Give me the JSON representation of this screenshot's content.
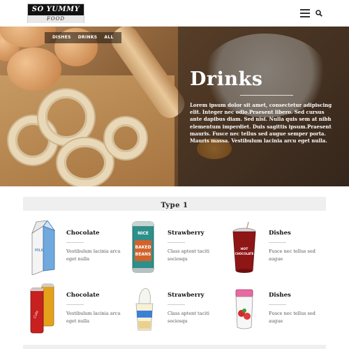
{
  "header": {
    "logo_line1": "SO YUMMY",
    "logo_line2": "FOOD",
    "icons": {
      "menu": "list-menu-icon",
      "search": "search-icon"
    }
  },
  "hero": {
    "tabs": [
      "DISHES",
      "DRINKS",
      "ALL"
    ],
    "title": "Drinks",
    "text": "Lorem ipsum dolor sit amet, consectetur adipiscing elit. Integer nec odio.Praesent libero. Sed cursus ante dapibus diam. Sed nisi. Nulla quis sem at nibh elementum imperdiet. Duis sagittis ipsum.Praesent mauris. Fusce nec tellus sed augue semper porta. Mauris massa. Vestibulum lacinia arcu eget nulla."
  },
  "section": {
    "title": "Type 1",
    "items": [
      {
        "name": "Chocolate",
        "desc": "Vestibulum lacinia arcu eget nulla",
        "thumb": "milk-carton"
      },
      {
        "name": "Strawberry",
        "desc": "Class aptent taciti sociosqu",
        "thumb": "baked-beans-can"
      },
      {
        "name": "Dishes",
        "desc": "Fusce nec tellus sed augue",
        "thumb": "hot-chocolate-cup"
      },
      {
        "name": "Chocolate",
        "desc": "Vestibulum lacinia arcu eget nulla",
        "thumb": "soda-cans"
      },
      {
        "name": "Strawberry",
        "desc": "Class aptent taciti sociosqu",
        "thumb": "ice-cream-cup"
      },
      {
        "name": "Dishes",
        "desc": "Fusce nec tellus sed augue",
        "thumb": "strawberry-jar"
      }
    ]
  },
  "colors": {
    "accent_dark": "#111111",
    "section_bg": "#efefef",
    "hero_overlay": "#2d231c"
  }
}
